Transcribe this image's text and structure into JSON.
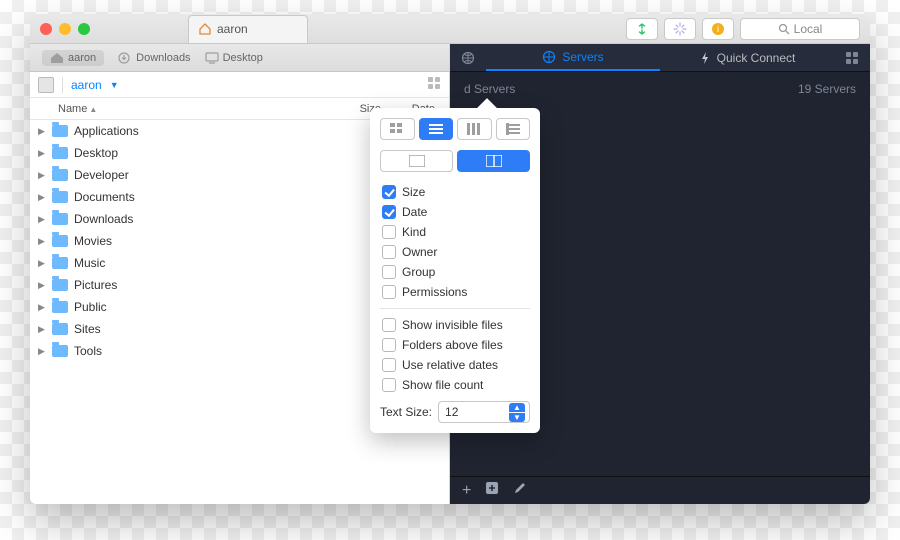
{
  "window": {
    "title": "aaron"
  },
  "titlebar": {
    "search_placeholder": "Local"
  },
  "left": {
    "tabs": [
      {
        "label": "aaron"
      },
      {
        "label": "Downloads"
      },
      {
        "label": "Desktop"
      }
    ],
    "path": "aaron",
    "columns": {
      "name": "Name",
      "size": "Size",
      "date": "Date"
    },
    "rows": [
      {
        "name": "Applications",
        "size": "•",
        "date": "•"
      },
      {
        "name": "Desktop",
        "size": "•",
        "date": "•"
      },
      {
        "name": "Developer",
        "size": "•",
        "date": "•"
      },
      {
        "name": "Documents",
        "size": "•",
        "date": "•"
      },
      {
        "name": "Downloads",
        "size": "•",
        "date": "•"
      },
      {
        "name": "Movies",
        "size": "•",
        "date": "•"
      },
      {
        "name": "Music",
        "size": "•",
        "date": "•"
      },
      {
        "name": "Pictures",
        "size": "•",
        "date": "•"
      },
      {
        "name": "Public",
        "size": "•",
        "date": "•"
      },
      {
        "name": "Sites",
        "size": "•",
        "date": "•"
      },
      {
        "name": "Tools",
        "size": "•",
        "date": "•"
      }
    ]
  },
  "right": {
    "tabs": {
      "servers": "Servers",
      "quick": "Quick Connect"
    },
    "shared_label": "d Servers",
    "count_label": "19 Servers"
  },
  "popover": {
    "cols": [
      {
        "label": "Size",
        "checked": true
      },
      {
        "label": "Date",
        "checked": true
      },
      {
        "label": "Kind",
        "checked": false
      },
      {
        "label": "Owner",
        "checked": false
      },
      {
        "label": "Group",
        "checked": false
      },
      {
        "label": "Permissions",
        "checked": false
      }
    ],
    "opts": [
      {
        "label": "Show invisible files",
        "checked": false
      },
      {
        "label": "Folders above files",
        "checked": false
      },
      {
        "label": "Use relative dates",
        "checked": false
      },
      {
        "label": "Show file count",
        "checked": false
      }
    ],
    "text_size_label": "Text Size:",
    "text_size_value": "12"
  }
}
